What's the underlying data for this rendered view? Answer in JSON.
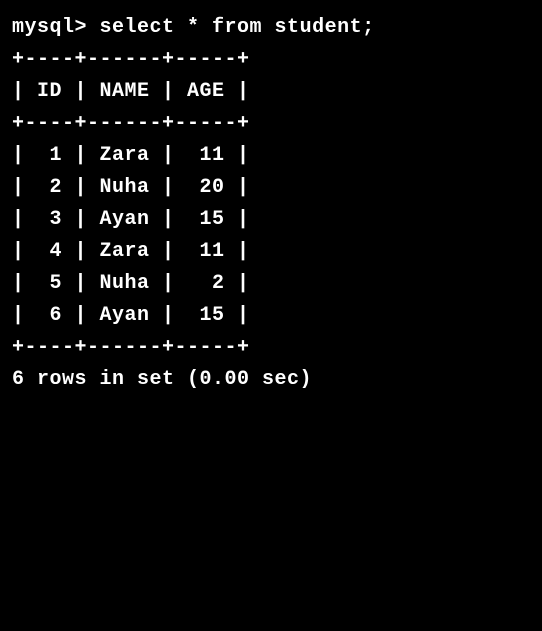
{
  "prompt": "mysql>",
  "query": "select * from student;",
  "separator": "+----+------+-----+",
  "columns": [
    "ID",
    "NAME",
    "AGE"
  ],
  "header_row": "| ID | NAME | AGE |",
  "rows": [
    {
      "id": 1,
      "name": "Zara",
      "age": 11,
      "text": "|  1 | Zara |  11 |"
    },
    {
      "id": 2,
      "name": "Nuha",
      "age": 20,
      "text": "|  2 | Nuha |  20 |"
    },
    {
      "id": 3,
      "name": "Ayan",
      "age": 15,
      "text": "|  3 | Ayan |  15 |"
    },
    {
      "id": 4,
      "name": "Zara",
      "age": 11,
      "text": "|  4 | Zara |  11 |"
    },
    {
      "id": 5,
      "name": "Nuha",
      "age": 2,
      "text": "|  5 | Nuha |   2 |"
    },
    {
      "id": 6,
      "name": "Ayan",
      "age": 15,
      "text": "|  6 | Ayan |  15 |"
    }
  ],
  "footer": "6 rows in set (0.00 sec)"
}
